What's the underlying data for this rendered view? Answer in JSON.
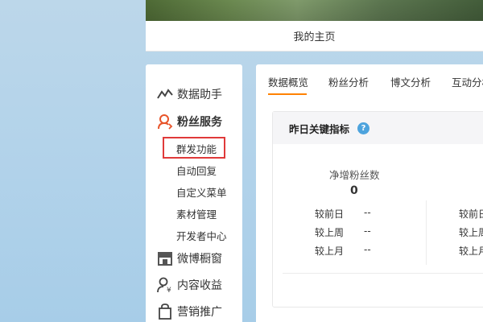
{
  "home": {
    "label": "我的主页"
  },
  "sidebar": {
    "groups": [
      {
        "label": "数据助手",
        "icon": "line-chart-icon"
      },
      {
        "label": "粉丝服务",
        "icon": "fans-service-icon"
      },
      {
        "label": "微博橱窗",
        "icon": "shop-window-icon"
      },
      {
        "label": "内容收益",
        "icon": "content-income-icon"
      },
      {
        "label": "营销推广",
        "icon": "marketing-bag-icon"
      }
    ],
    "sub_items": [
      "群发功能",
      "自动回复",
      "自定义菜单",
      "素材管理",
      "开发者中心"
    ],
    "accent": "#e8542a",
    "highlight_color": "#e03a3a"
  },
  "tabs": [
    "数据概览",
    "粉丝分析",
    "博文分析",
    "互动分析"
  ],
  "panel": {
    "title": "昨日关键指标",
    "help_icon": "question-icon",
    "metric_title": "净增粉丝数",
    "metric_value": "0",
    "comparisons": [
      {
        "label": "较前日",
        "value": "--"
      },
      {
        "label": "较上周",
        "value": "--"
      },
      {
        "label": "较上月",
        "value": "--"
      }
    ],
    "comparisons_right": [
      "较前日",
      "较上周",
      "较上月"
    ]
  },
  "colors": {
    "tab_underline": "#ff8200",
    "help_icon": "#4da3dd"
  }
}
